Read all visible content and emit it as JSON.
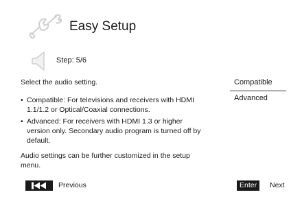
{
  "header": {
    "icon": "wrench-icon",
    "title": "Easy Setup"
  },
  "step": {
    "icon": "speaker-icon",
    "label": "Step: 5/6"
  },
  "content": {
    "instruction": "Select the audio setting.",
    "bullets": [
      "Compatible: For televisions and receivers with HDMI 1.1/1.2 or Optical/Coaxial connections.",
      "Advanced: For receivers with HDMI 1.3 or higher version only. Secondary audio program is turned off by default."
    ],
    "note": "Audio settings can be further customized in the setup menu."
  },
  "options": {
    "items": [
      {
        "label": "Compatible",
        "selected": true
      },
      {
        "label": "Advanced",
        "selected": false
      }
    ]
  },
  "footer": {
    "previous_icon": "skip-previous-icon",
    "previous_label": "Previous",
    "enter_label": "Enter",
    "next_label": "Next"
  }
}
